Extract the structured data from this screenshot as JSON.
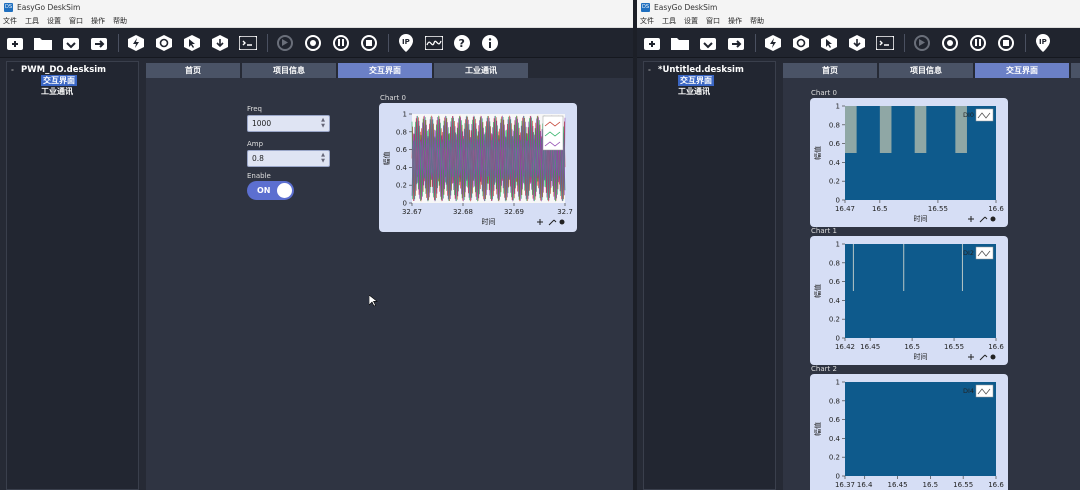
{
  "left": {
    "title": "EasyGo DeskSim",
    "logo": "DS",
    "menu": [
      "文件",
      "工具",
      "设置",
      "窗口",
      "操作",
      "帮助"
    ],
    "tree_root": "PWM_DO.desksim",
    "tree_children": [
      "交互界面",
      "工业通讯"
    ],
    "tabs": [
      "首页",
      "项目信息",
      "交互界面",
      "工业通讯"
    ],
    "freq_label": "Freq",
    "freq_value": "1000",
    "amp_label": "Amp",
    "amp_value": "0.8",
    "enable_label": "Enable",
    "enable_state": "ON",
    "chart_title": "Chart 0",
    "chart_xlabel": "时间",
    "chart_ylabel": "幅值"
  },
  "right": {
    "title": "EasyGo DeskSim",
    "logo": "DS",
    "menu": [
      "文件",
      "工具",
      "设置",
      "窗口",
      "操作",
      "帮助"
    ],
    "tree_root": "*Untitled.desksim",
    "tree_children": [
      "交互界面",
      "工业通讯"
    ],
    "tabs": [
      "首页",
      "项目信息",
      "交互界面"
    ],
    "chart_titles": [
      "Chart 0",
      "Chart 1",
      "Chart 2"
    ],
    "chart_xlabel": "时间",
    "chart_ylabel": "幅值"
  },
  "colors": {
    "accent": "#6b80c6",
    "plot_blue": "#0e5a8c",
    "card": "#d6def5"
  },
  "chart_data": [
    {
      "type": "line",
      "title": "Chart 0",
      "xlabel": "时间",
      "ylabel": "幅值",
      "xticks": [
        "32.67",
        "32.68",
        "32.69",
        "32.7"
      ],
      "yticks": [
        "0",
        "0.2",
        "0.4",
        "0.6",
        "0.8",
        "1"
      ],
      "xlim": [
        32.67,
        32.7
      ],
      "ylim": [
        0,
        1
      ],
      "series": [
        {
          "color": "#c0392b"
        },
        {
          "color": "#27ae60"
        },
        {
          "color": "#8e44ad"
        }
      ]
    },
    {
      "type": "area",
      "title": "Chart 0",
      "xlabel": "时间",
      "ylabel": "幅值",
      "legend": "DI0",
      "xticks": [
        "16.47",
        "16.5",
        "16.55",
        "16.6"
      ],
      "xlim": [
        16.47,
        16.6
      ],
      "ylim": [
        0,
        1
      ],
      "yticks": [
        "0",
        "0.2",
        "0.4",
        "0.6",
        "0.8",
        "1"
      ],
      "low_intervals": [
        [
          16.47,
          16.48
        ],
        [
          16.5,
          16.51
        ],
        [
          16.53,
          16.54
        ],
        [
          16.565,
          16.575
        ]
      ],
      "high": 1,
      "low": 0.5
    },
    {
      "type": "area",
      "title": "Chart 1",
      "xlabel": "时间",
      "ylabel": "幅值",
      "legend": "DI2",
      "xticks": [
        "16.42",
        "16.45",
        "16.5",
        "16.55",
        "16.6"
      ],
      "xlim": [
        16.42,
        16.6
      ],
      "ylim": [
        0,
        1
      ],
      "yticks": [
        "0",
        "0.2",
        "0.4",
        "0.6",
        "0.8",
        "1"
      ],
      "spikes": [
        16.43,
        16.49,
        16.56
      ],
      "high": 1,
      "low": 0.5
    },
    {
      "type": "area",
      "title": "Chart 2",
      "xlabel": "时间",
      "ylabel": "幅值",
      "legend": "DI4",
      "xticks": [
        "16.37",
        "16.4",
        "16.45",
        "16.5",
        "16.55",
        "16.6"
      ],
      "xlim": [
        16.37,
        16.6
      ],
      "ylim": [
        0,
        1
      ],
      "yticks": [
        "0",
        "0.2",
        "0.4",
        "0.6",
        "0.8",
        "1"
      ]
    }
  ]
}
